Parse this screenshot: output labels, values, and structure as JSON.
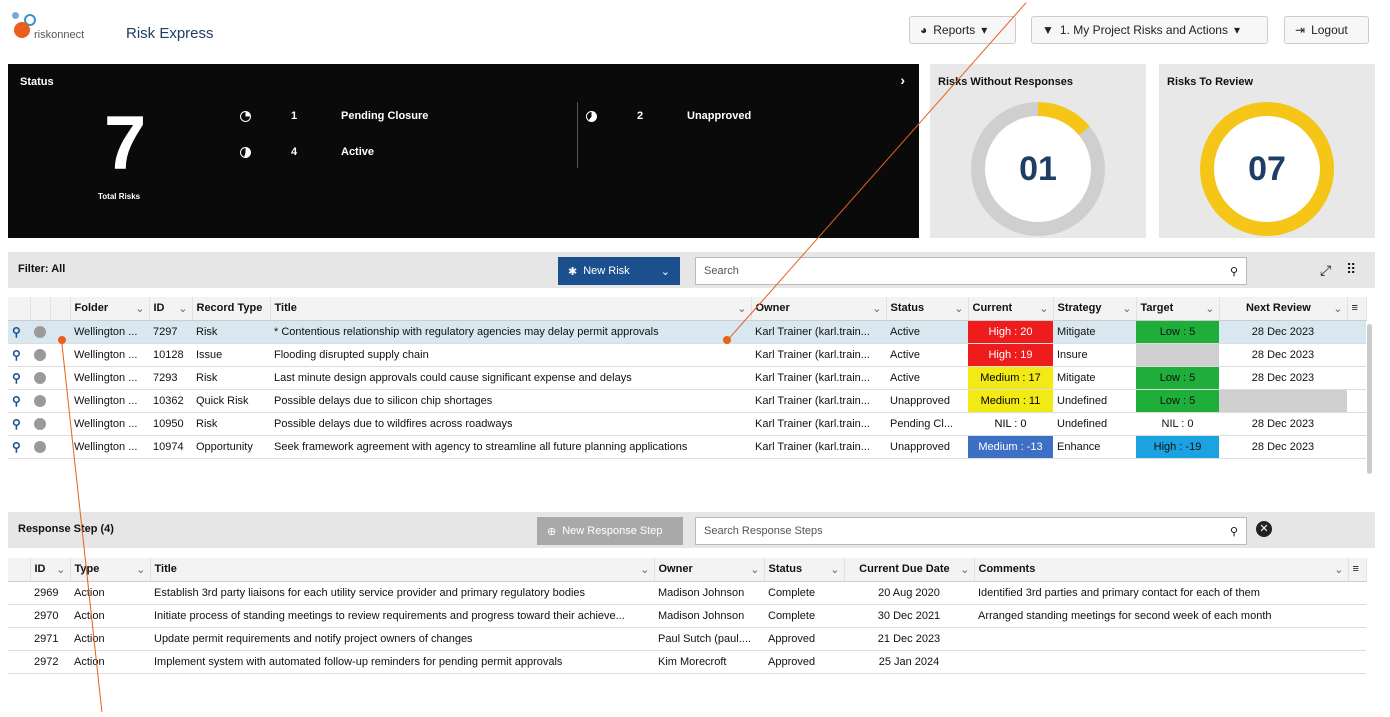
{
  "header": {
    "logo_text": "riskonnect",
    "app_title": "Risk Express",
    "reports_label": "Reports",
    "view_label": "1. My Project Risks and Actions",
    "logout_label": "Logout"
  },
  "status": {
    "label": "Status",
    "total": "7",
    "total_label": "Total Risks",
    "items": [
      {
        "count": "1",
        "label": "Pending Closure"
      },
      {
        "count": "2",
        "label": "Unapproved"
      },
      {
        "count": "4",
        "label": "Active"
      }
    ]
  },
  "cards": [
    {
      "title": "Risks Without Responses",
      "value": "01",
      "fraction": 0.14
    },
    {
      "title": "Risks To Review",
      "value": "07",
      "fraction": 1.0
    }
  ],
  "filter": {
    "label": "Filter: All",
    "new_risk": "New Risk",
    "search_placeholder": "Search"
  },
  "risk_table": {
    "columns": [
      "Folder",
      "ID",
      "Record Type",
      "Title",
      "Owner",
      "Status",
      "Current",
      "Strategy",
      "Target",
      "Next Review"
    ],
    "rows": [
      {
        "folder": "Wellington ...",
        "id": "7297",
        "type": "Risk",
        "title": "* Contentious relationship with regulatory agencies may delay permit approvals",
        "owner": "Karl Trainer (karl.train...",
        "status": "Active",
        "current": "High : 20",
        "current_color": "#ee1c1c",
        "strategy": "Mitigate",
        "target": "Low : 5",
        "target_color": "#1fae3a",
        "review": "28 Dec 2023"
      },
      {
        "folder": "Wellington ...",
        "id": "10128",
        "type": "Issue",
        "title": "Flooding disrupted supply chain",
        "owner": "Karl Trainer (karl.train...",
        "status": "Active",
        "current": "High : 19",
        "current_color": "#ee1c1c",
        "strategy": "Insure",
        "target": "",
        "target_color": "#d0d0d0",
        "review": "28 Dec 2023"
      },
      {
        "folder": "Wellington ...",
        "id": "7293",
        "type": "Risk",
        "title": "Last minute design approvals could cause significant expense and delays",
        "owner": "Karl Trainer (karl.train...",
        "status": "Active",
        "current": "Medium : 17",
        "current_color": "#f2ea14",
        "strategy": "Mitigate",
        "target": "Low : 5",
        "target_color": "#1fae3a",
        "review": "28 Dec 2023"
      },
      {
        "folder": "Wellington ...",
        "id": "10362",
        "type": "Quick Risk",
        "title": "Possible delays due to silicon chip shortages",
        "owner": "Karl Trainer (karl.train...",
        "status": "Unapproved",
        "current": "Medium : 11",
        "current_color": "#f2ea14",
        "strategy": "Undefined",
        "target": "Low : 5",
        "target_color": "#1fae3a",
        "review": ""
      },
      {
        "folder": "Wellington ...",
        "id": "10950",
        "type": "Risk",
        "title": "Possible delays due to wildfires across roadways",
        "owner": "Karl Trainer (karl.train...",
        "status": "Pending Cl...",
        "current": "NIL : 0",
        "current_color": "#ffffff",
        "strategy": "Undefined",
        "target": "NIL : 0",
        "target_color": "#ffffff",
        "review": "28 Dec 2023"
      },
      {
        "folder": "Wellington ...",
        "id": "10974",
        "type": "Opportunity",
        "title": "Seek framework agreement with agency to streamline all future planning applications",
        "owner": "Karl Trainer (karl.train...",
        "status": "Unapproved",
        "current": "Medium : -13",
        "current_color": "#3d6fc4",
        "strategy": "Enhance",
        "target": "High : -19",
        "target_color": "#1aa3e0",
        "review": "28 Dec 2023"
      }
    ]
  },
  "response": {
    "label": "Response Step (4)",
    "new_step": "New Response Step",
    "search_placeholder": "Search Response Steps",
    "columns": [
      "ID",
      "Type",
      "Title",
      "Owner",
      "Status",
      "Current Due Date",
      "Comments"
    ],
    "rows": [
      {
        "id": "2969",
        "type": "Action",
        "title": "Establish 3rd party liaisons for each utility service provider and primary regulatory bodies",
        "owner": "Madison Johnson",
        "status": "Complete",
        "due": "20 Aug 2020",
        "comments": "Identified 3rd parties and primary contact for each of them"
      },
      {
        "id": "2970",
        "type": "Action",
        "title": "Initiate process of standing meetings to review requirements and progress toward their achieve...",
        "owner": "Madison Johnson",
        "status": "Complete",
        "due": "30 Dec 2021",
        "comments": "Arranged standing meetings for second week of each month"
      },
      {
        "id": "2971",
        "type": "Action",
        "title": "Update permit requirements and notify project owners of changes",
        "owner": "Paul Sutch (paul....",
        "status": "Approved",
        "due": "21 Dec 2023",
        "comments": ""
      },
      {
        "id": "2972",
        "type": "Action",
        "title": "Implement system with automated follow-up reminders for pending permit approvals",
        "owner": "Kim Morecroft",
        "status": "Approved",
        "due": "25 Jan 2024",
        "comments": ""
      }
    ]
  }
}
